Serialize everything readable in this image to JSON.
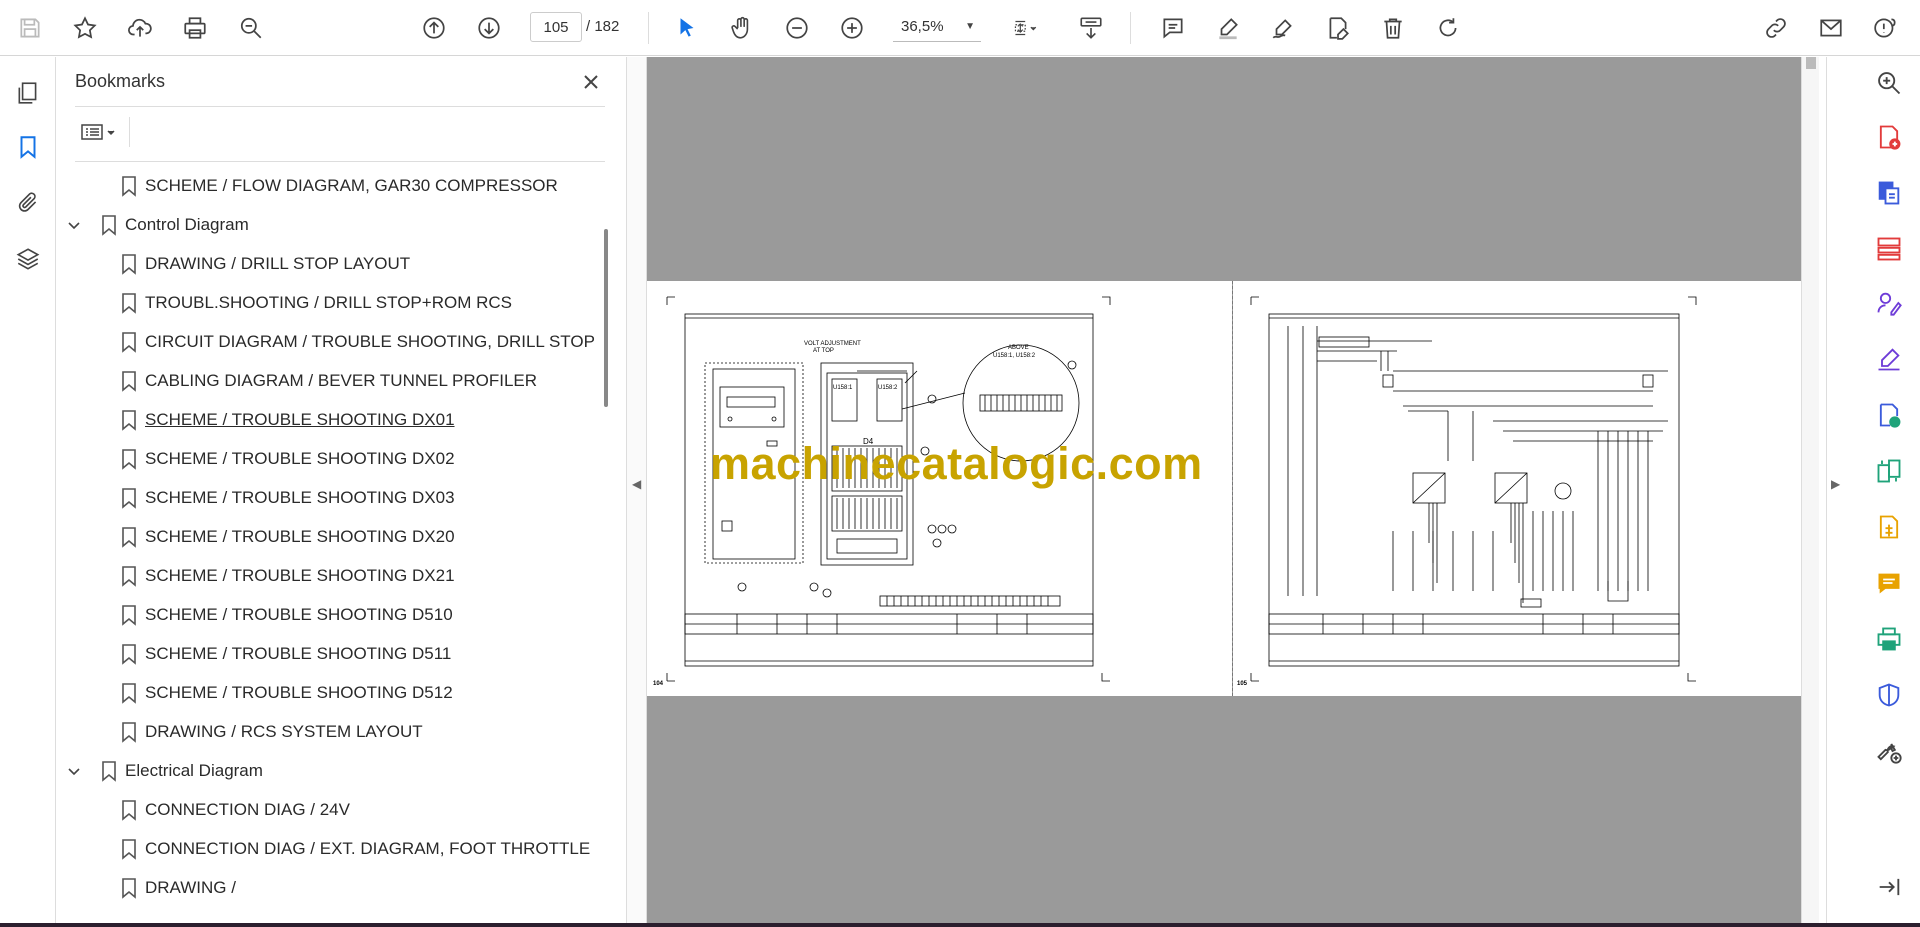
{
  "toolbar": {
    "page_current": "105",
    "page_total": "/ 182",
    "zoom": "36,5%"
  },
  "bookmarks": {
    "title": "Bookmarks",
    "items": [
      {
        "label": "SCHEME / FLOW DIAGRAM, GAR30 COMPRESSOR",
        "level": 2
      },
      {
        "label": "Control Diagram",
        "level": 1,
        "expanded": true
      },
      {
        "label": "DRAWING / DRILL STOP LAYOUT",
        "level": 2
      },
      {
        "label": "TROUBL.SHOOTING / DRILL STOP+ROM RCS",
        "level": 2
      },
      {
        "label": "CIRCUIT DIAGRAM / TROUBLE SHOOTING, DRILL STOP",
        "level": 2
      },
      {
        "label": "CABLING DIAGRAM / BEVER TUNNEL PROFILER",
        "level": 2
      },
      {
        "label": "SCHEME / TROUBLE SHOOTING DX01",
        "level": 2,
        "hover": true
      },
      {
        "label": "SCHEME / TROUBLE SHOOTING DX02",
        "level": 2
      },
      {
        "label": "SCHEME / TROUBLE SHOOTING DX03",
        "level": 2
      },
      {
        "label": "SCHEME / TROUBLE SHOOTING DX20",
        "level": 2
      },
      {
        "label": "SCHEME / TROUBLE SHOOTING DX21",
        "level": 2
      },
      {
        "label": "SCHEME / TROUBLE SHOOTING D510",
        "level": 2
      },
      {
        "label": "SCHEME / TROUBLE SHOOTING D511",
        "level": 2
      },
      {
        "label": "SCHEME / TROUBLE SHOOTING D512",
        "level": 2
      },
      {
        "label": "DRAWING / RCS SYSTEM LAYOUT",
        "level": 2
      },
      {
        "label": "Electrical Diagram",
        "level": 1,
        "expanded": true
      },
      {
        "label": "CONNECTION DIAG / 24V",
        "level": 2
      },
      {
        "label": "CONNECTION DIAG / EXT. DIAGRAM, FOOT THROTTLE",
        "level": 2
      },
      {
        "label": "DRAWING /",
        "level": 2
      }
    ]
  },
  "document": {
    "left_page_number": "104",
    "right_page_number": "105",
    "watermark": "machinecatalogic.com",
    "left_labels": {
      "volt_adjust": "VOLT ADJUSTMENT",
      "at_top": "AT TOP",
      "u158_1": "U158:1",
      "u158_2": "U158:2",
      "above": "ABOVE",
      "above_sub": "U158:1, U158:2",
      "d4": "D4"
    }
  },
  "colors": {
    "accent": "#1473e6",
    "watermark": "#c8a300",
    "viewer_bg": "#9a9a9a",
    "purple_icon": "#6e3cd8"
  }
}
